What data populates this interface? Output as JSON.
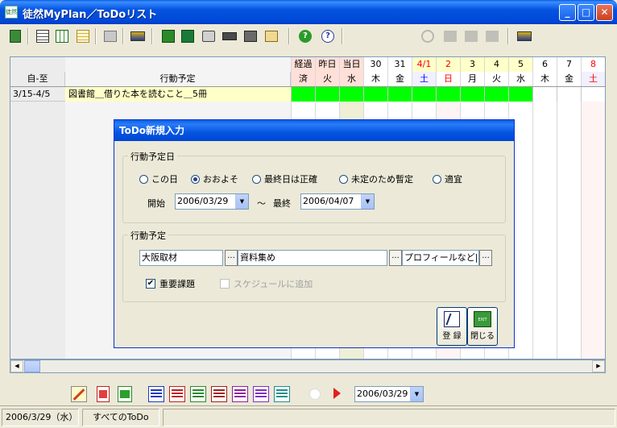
{
  "window": {
    "title": "徒然MyPlan／ToDoリスト",
    "icon_label": "徒然"
  },
  "grid": {
    "header_top": [
      "経過",
      "昨日",
      "当日",
      "30",
      "31",
      "4/1",
      "2",
      "3",
      "4",
      "5",
      "6",
      "7",
      "8"
    ],
    "header_bottom": [
      "済",
      "火",
      "水",
      "木",
      "金",
      "土",
      "日",
      "月",
      "火",
      "水",
      "木",
      "金",
      "土"
    ],
    "col_range_header": "自-至",
    "col_plan_header": "行動予定",
    "rows": [
      {
        "range": "3/15-4/5",
        "plan": "図書館＿借りた本を読むこと＿5冊"
      }
    ]
  },
  "dialog": {
    "title": "ToDo新規入力",
    "date_group_label": "行動予定日",
    "date_options": [
      "この日",
      "おおよそ",
      "最終日は正確",
      "未定のため暫定",
      "適宜"
    ],
    "date_selected": "おおよそ",
    "start_label": "開始",
    "start_value": "2006/03/29",
    "tilde": "～",
    "end_label": "最終",
    "end_value": "2006/04/07",
    "plan_group_label": "行動予定",
    "plan_fields": [
      "大阪取材",
      "資料集め",
      "プロフィールなど|"
    ],
    "ellipsis": "...",
    "important_label": "重要課題",
    "important_checked": true,
    "schedule_label": "スケジュールに追加",
    "register_label": "登 録",
    "close_label": "閉じる",
    "exit_caption": "EXIT"
  },
  "bottom": {
    "date_value": "2006/03/29"
  },
  "status": {
    "date": "2006/3/29（水）",
    "filter": "すべてのToDo"
  },
  "colors": {
    "done_green": "#00ff00",
    "today_col": "#efefd6",
    "sat_blue": "#0000ff",
    "sun_red": "#ff0000",
    "header_yellow": "#ffffe0"
  }
}
